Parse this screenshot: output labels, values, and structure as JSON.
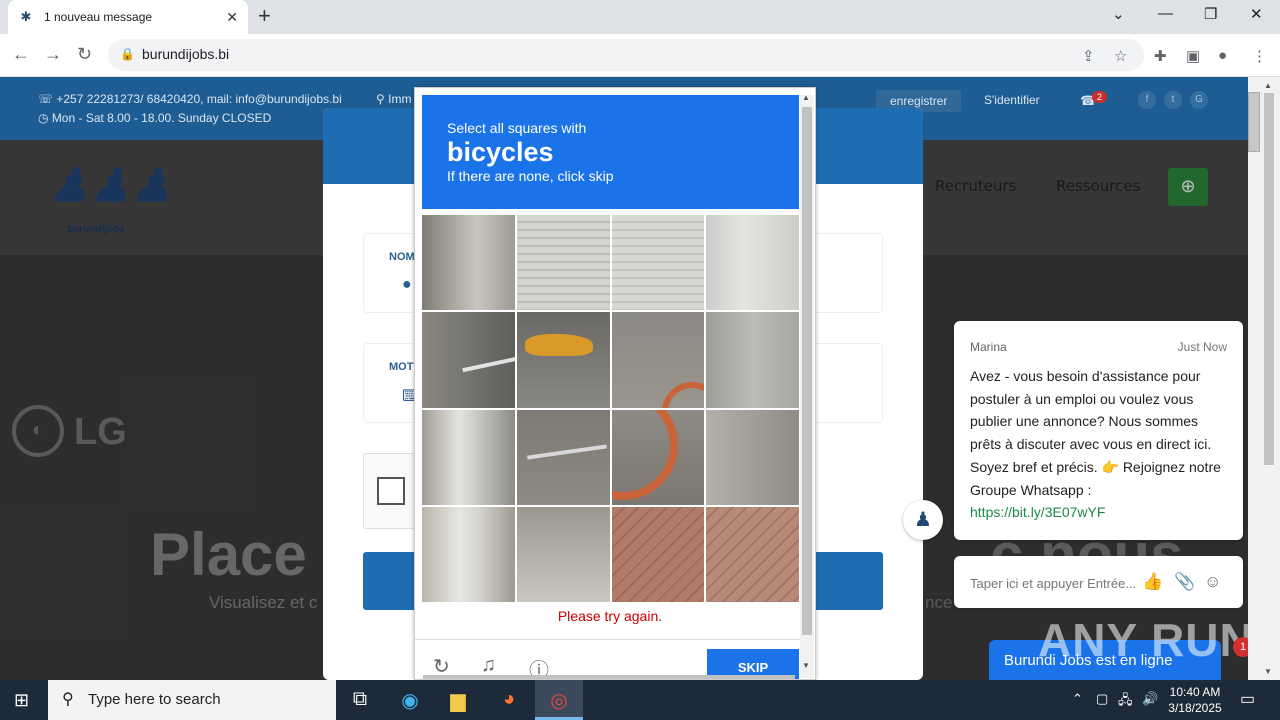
{
  "browser": {
    "tab_title": "1 nouveau message",
    "url": "burundijobs.bi"
  },
  "site": {
    "contact_line": "+257 22281273/ 68420420, mail: info@burundijobs.bi",
    "address_fragment": "Imm",
    "hours": "Mon - Sat 8.00 - 18.00. Sunday CLOSED",
    "register_label": "enregistrer",
    "login_label": "S'identifier",
    "notif_count": "2",
    "logo_text": "burundijobs",
    "menu": [
      "Recruteurs",
      "Ressources"
    ],
    "hero_title_left": "Place",
    "hero_title_right": "c nous",
    "hero_sub_left": "Visualisez et c",
    "hero_sub_right": "nce",
    "brand_bg": "LG"
  },
  "login_modal": {
    "name_label": "NOM",
    "password_label": "MOT"
  },
  "captcha": {
    "instruction": "Select all squares with",
    "target": "bicycles",
    "hint": "If there are none, click skip",
    "error": "Please try again.",
    "skip_label": "SKIP"
  },
  "chat": {
    "agent_name": "Marina",
    "time": "Just Now",
    "message": "Avez - vous besoin d'assistance pour postuler à un emploi ou voulez vous publier une annonce? Nous sommes prêts à discuter avec vous en direct ici. Soyez bref et précis. 👉 Rejoignez notre Groupe Whatsapp :",
    "link": "https://bit.ly/3E07wYF",
    "input_placeholder": "Taper ici et appuyer Entrée...",
    "online_label": "Burundi Jobs est en ligne",
    "unread_count": "1"
  },
  "watermark": "ANY RUN",
  "taskbar": {
    "search_placeholder": "Type here to search",
    "time": "10:40 AM",
    "date": "3/18/2025"
  },
  "colors": {
    "captcha_blue": "#1a73e8",
    "site_blue": "#1e5d94",
    "error_red": "#cc0000",
    "link_green": "#1a8a4a"
  }
}
